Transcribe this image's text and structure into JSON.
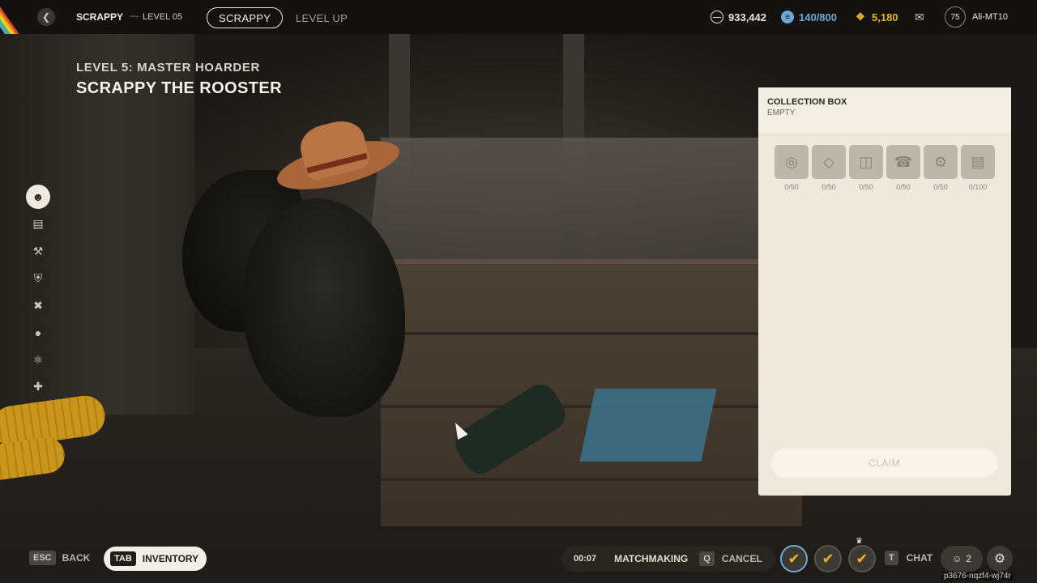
{
  "topbar": {
    "breadcrumb_trader": "SCRAPPY",
    "breadcrumb_sep": "—",
    "breadcrumb_level": "LEVEL 05",
    "tabs": [
      {
        "label": "SCRAPPY",
        "active": true
      },
      {
        "label": "LEVEL UP",
        "active": false
      }
    ],
    "stats": [
      {
        "icon": "coin-icon",
        "value": "933,442",
        "color": "#e9e4da"
      },
      {
        "icon": "stash-icon",
        "value": "140/800",
        "color": "#6fa8d6"
      },
      {
        "icon": "raider-token-icon",
        "value": "5,180",
        "color": "#e8b21e"
      }
    ],
    "player_level": "75",
    "username": "Ali-MT10"
  },
  "header": {
    "level_title": "LEVEL 5: MASTER HOARDER",
    "trader_name": "SCRAPPY THE ROOSTER"
  },
  "rail": [
    {
      "icon": "rooster-icon",
      "active": true
    },
    {
      "icon": "bench-icon",
      "active": false
    },
    {
      "icon": "workshop-icon",
      "active": false
    },
    {
      "icon": "shield-icon",
      "active": false
    },
    {
      "icon": "tools-icon",
      "active": false
    },
    {
      "icon": "grenade-icon",
      "active": false
    },
    {
      "icon": "atom-icon",
      "active": false
    },
    {
      "icon": "medkit-icon",
      "active": false
    }
  ],
  "collection": {
    "title": "COLLECTION BOX",
    "status": "EMPTY",
    "slots": [
      {
        "icon": "coil-icon",
        "count": "0/50"
      },
      {
        "icon": "fabric-icon",
        "count": "0/50"
      },
      {
        "icon": "jar-icon",
        "count": "0/50"
      },
      {
        "icon": "phone-icon",
        "count": "0/50"
      },
      {
        "icon": "metal-parts-icon",
        "count": "0/50"
      },
      {
        "icon": "paper-icon",
        "count": "0/100"
      }
    ],
    "claim_label": "CLAIM"
  },
  "bottombar": {
    "back_key": "ESC",
    "back_label": "BACK",
    "inventory_key": "TAB",
    "inventory_label": "INVENTORY",
    "timer": "00:07",
    "matchmaking_label": "MATCHMAKING",
    "cancel_key": "Q",
    "cancel_label": "CANCEL",
    "chat_key": "T",
    "chat_label": "CHAT",
    "friends_count": "2",
    "session_id": "p3676-nqzf4-wj74r"
  }
}
